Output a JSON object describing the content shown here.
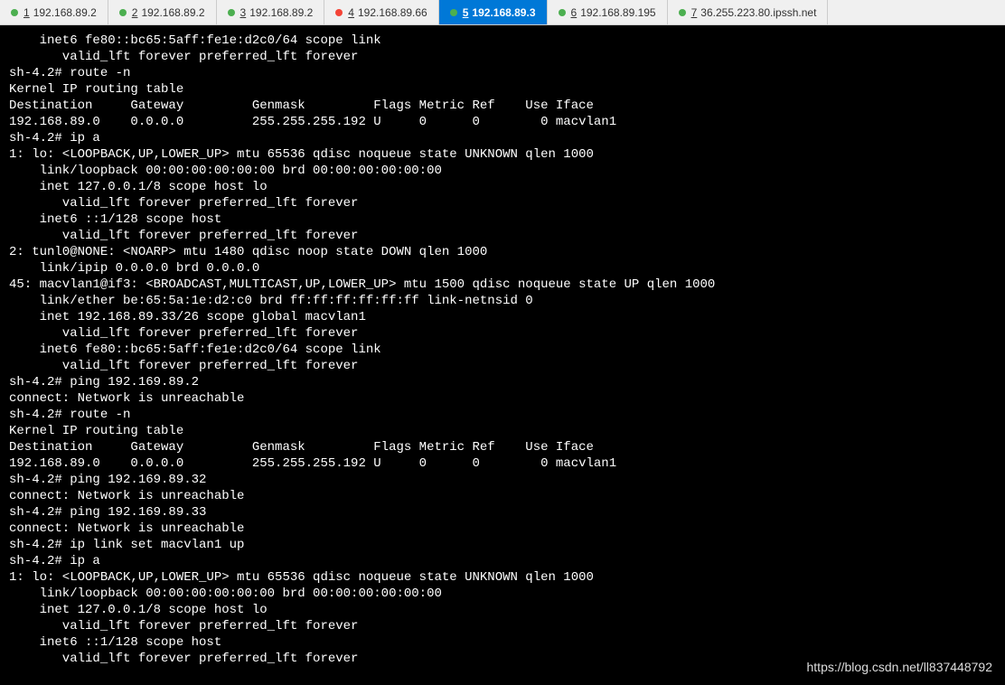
{
  "tabs": [
    {
      "num": "1",
      "label": "192.168.89.2",
      "dot": "green",
      "active": false
    },
    {
      "num": "2",
      "label": "192.168.89.2",
      "dot": "green",
      "active": false
    },
    {
      "num": "3",
      "label": "192.168.89.2",
      "dot": "green",
      "active": false
    },
    {
      "num": "4",
      "label": "192.168.89.66",
      "dot": "red",
      "active": false
    },
    {
      "num": "5",
      "label": "192.168.89.3",
      "dot": "green",
      "active": true
    },
    {
      "num": "6",
      "label": "192.168.89.195",
      "dot": "green",
      "active": false
    },
    {
      "num": "7",
      "label": "36.255.223.80.ipssh.net",
      "dot": "green",
      "active": false
    }
  ],
  "terminal_lines": [
    "    inet6 fe80::bc65:5aff:fe1e:d2c0/64 scope link",
    "       valid_lft forever preferred_lft forever",
    "sh-4.2# route -n",
    "Kernel IP routing table",
    "Destination     Gateway         Genmask         Flags Metric Ref    Use Iface",
    "192.168.89.0    0.0.0.0         255.255.255.192 U     0      0        0 macvlan1",
    "sh-4.2# ip a",
    "1: lo: <LOOPBACK,UP,LOWER_UP> mtu 65536 qdisc noqueue state UNKNOWN qlen 1000",
    "    link/loopback 00:00:00:00:00:00 brd 00:00:00:00:00:00",
    "    inet 127.0.0.1/8 scope host lo",
    "       valid_lft forever preferred_lft forever",
    "    inet6 ::1/128 scope host",
    "       valid_lft forever preferred_lft forever",
    "2: tunl0@NONE: <NOARP> mtu 1480 qdisc noop state DOWN qlen 1000",
    "    link/ipip 0.0.0.0 brd 0.0.0.0",
    "45: macvlan1@if3: <BROADCAST,MULTICAST,UP,LOWER_UP> mtu 1500 qdisc noqueue state UP qlen 1000",
    "    link/ether be:65:5a:1e:d2:c0 brd ff:ff:ff:ff:ff:ff link-netnsid 0",
    "    inet 192.168.89.33/26 scope global macvlan1",
    "       valid_lft forever preferred_lft forever",
    "    inet6 fe80::bc65:5aff:fe1e:d2c0/64 scope link",
    "       valid_lft forever preferred_lft forever",
    "sh-4.2# ping 192.169.89.2",
    "connect: Network is unreachable",
    "sh-4.2# route -n",
    "Kernel IP routing table",
    "Destination     Gateway         Genmask         Flags Metric Ref    Use Iface",
    "192.168.89.0    0.0.0.0         255.255.255.192 U     0      0        0 macvlan1",
    "sh-4.2# ping 192.169.89.32",
    "connect: Network is unreachable",
    "sh-4.2# ping 192.169.89.33",
    "connect: Network is unreachable",
    "sh-4.2# ip link set macvlan1 up",
    "sh-4.2# ip a",
    "1: lo: <LOOPBACK,UP,LOWER_UP> mtu 65536 qdisc noqueue state UNKNOWN qlen 1000",
    "    link/loopback 00:00:00:00:00:00 brd 00:00:00:00:00:00",
    "    inet 127.0.0.1/8 scope host lo",
    "       valid_lft forever preferred_lft forever",
    "    inet6 ::1/128 scope host",
    "       valid_lft forever preferred_lft forever"
  ],
  "watermark": "https://blog.csdn.net/ll837448792"
}
